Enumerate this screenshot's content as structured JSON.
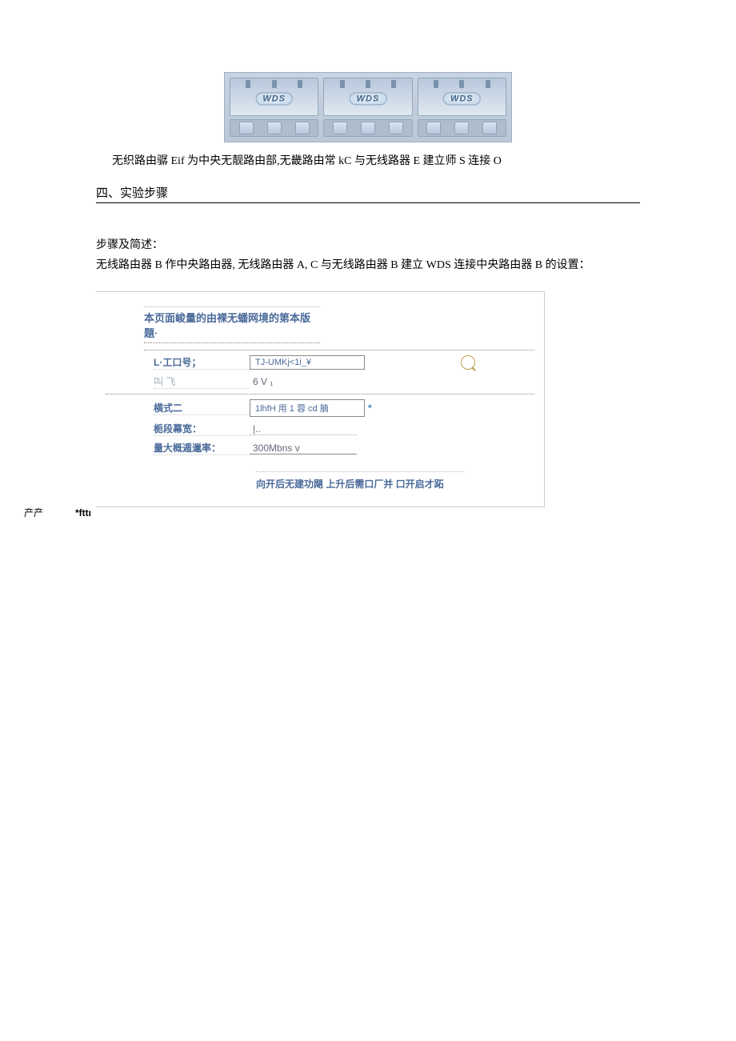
{
  "diagram": {
    "labels": [
      "WDS",
      "WDS",
      "WDS"
    ]
  },
  "caption": "无织路由骣 Eif 为中央无靓路由部,无畿路由常 kC 与无线路器 E 建立师 S 连接 O",
  "section_title": "四、实验步骤",
  "para_label": "步骤及简述：",
  "para_body": "无线路由器 B 作中央路由器, 无线路由器 A, C 与无线路由器 B 建立 WDS 连接中央路由器 B 的设置：",
  "config": {
    "title": "本页面峻量的由裸无蟠网境的第本版題·",
    "rows": {
      "ssid_label": "L·工口号；",
      "ssid_value": "TJ-UMKj<1i_¥",
      "channel_label": "叫 飞",
      "channel_value": "6 V  ₁",
      "mode_label": "横式二",
      "mode_value": "1lhfH 用 1 蓉 cd 腩",
      "bandwidth_label": "栀段幕宽：",
      "bandwidth_value": "|..",
      "rate_label": "量大概遁邋率：",
      "rate_value": "300Mbns v"
    },
    "footer_note": "向开后无建功飓 上升后需口厂并 口开启才跖"
  },
  "bottom": {
    "left": "产产",
    "right": "*fttı"
  }
}
